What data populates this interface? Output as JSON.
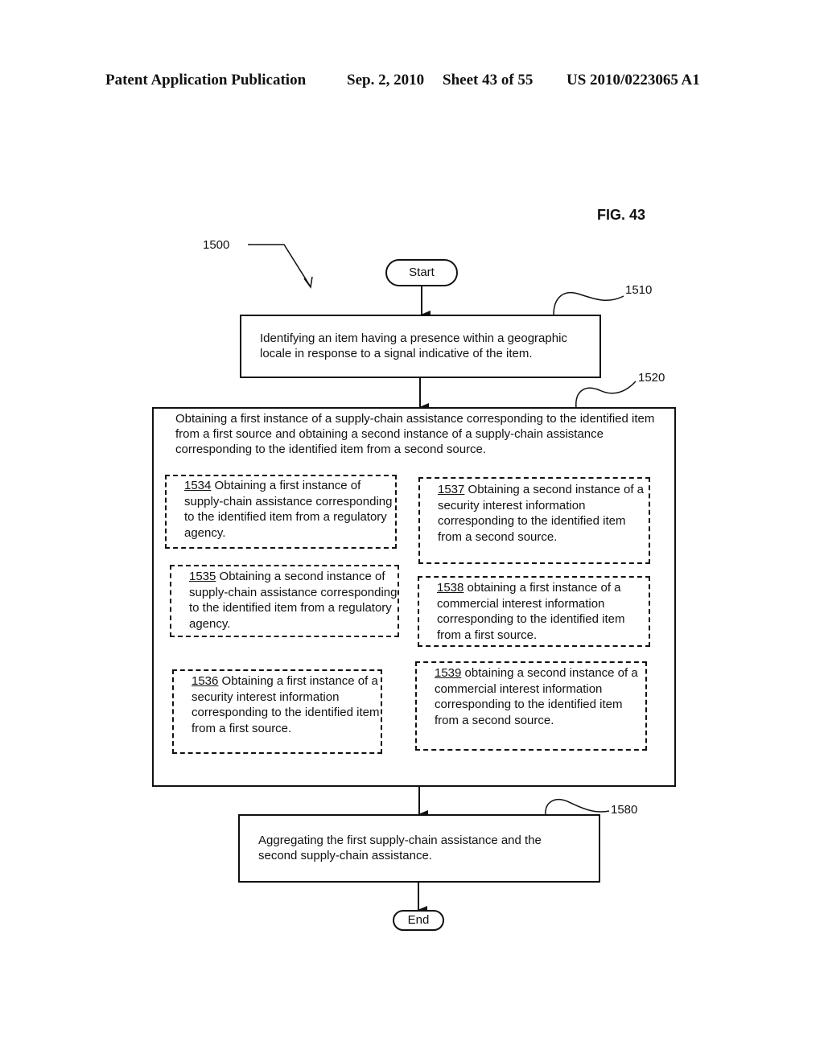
{
  "header": {
    "publication": "Patent Application Publication",
    "date": "Sep. 2, 2010",
    "sheet": "Sheet 43 of 55",
    "number": "US 2010/0223065 A1"
  },
  "figure": {
    "title": "FIG. 43",
    "ref": "1500"
  },
  "flow": {
    "start": "Start",
    "end": "End",
    "step1": {
      "ref": "1510",
      "text": "Identifying an item having a presence within a geographic locale in response to a signal indicative of the item."
    },
    "step2": {
      "ref": "1520",
      "text": "Obtaining a first instance of a supply-chain assistance corresponding to the identified item from a first source and obtaining a second instance of a supply-chain assistance corresponding to the identified item from a second source.",
      "options": [
        {
          "num": "1534",
          "text": " Obtaining a first instance of supply-chain assistance corresponding to the identified item from a regulatory agency."
        },
        {
          "num": "1535",
          "text": " Obtaining a second instance of supply-chain assistance corresponding to the identified item from a regulatory agency."
        },
        {
          "num": "1536",
          "text": " Obtaining a first instance of a security interest information corresponding to the identified item from a first source."
        },
        {
          "num": "1537",
          "text": " Obtaining a second instance of a security interest information corresponding to the identified item from a second source."
        },
        {
          "num": "1538",
          "text": " obtaining a first instance of a commercial interest information corresponding to the identified item from a first source."
        },
        {
          "num": "1539",
          "text": " obtaining a second instance of a commercial interest information corresponding to the identified item from a second source."
        }
      ]
    },
    "step3": {
      "ref": "1580",
      "text": "Aggregating the first supply-chain assistance and the second supply-chain assistance."
    }
  }
}
